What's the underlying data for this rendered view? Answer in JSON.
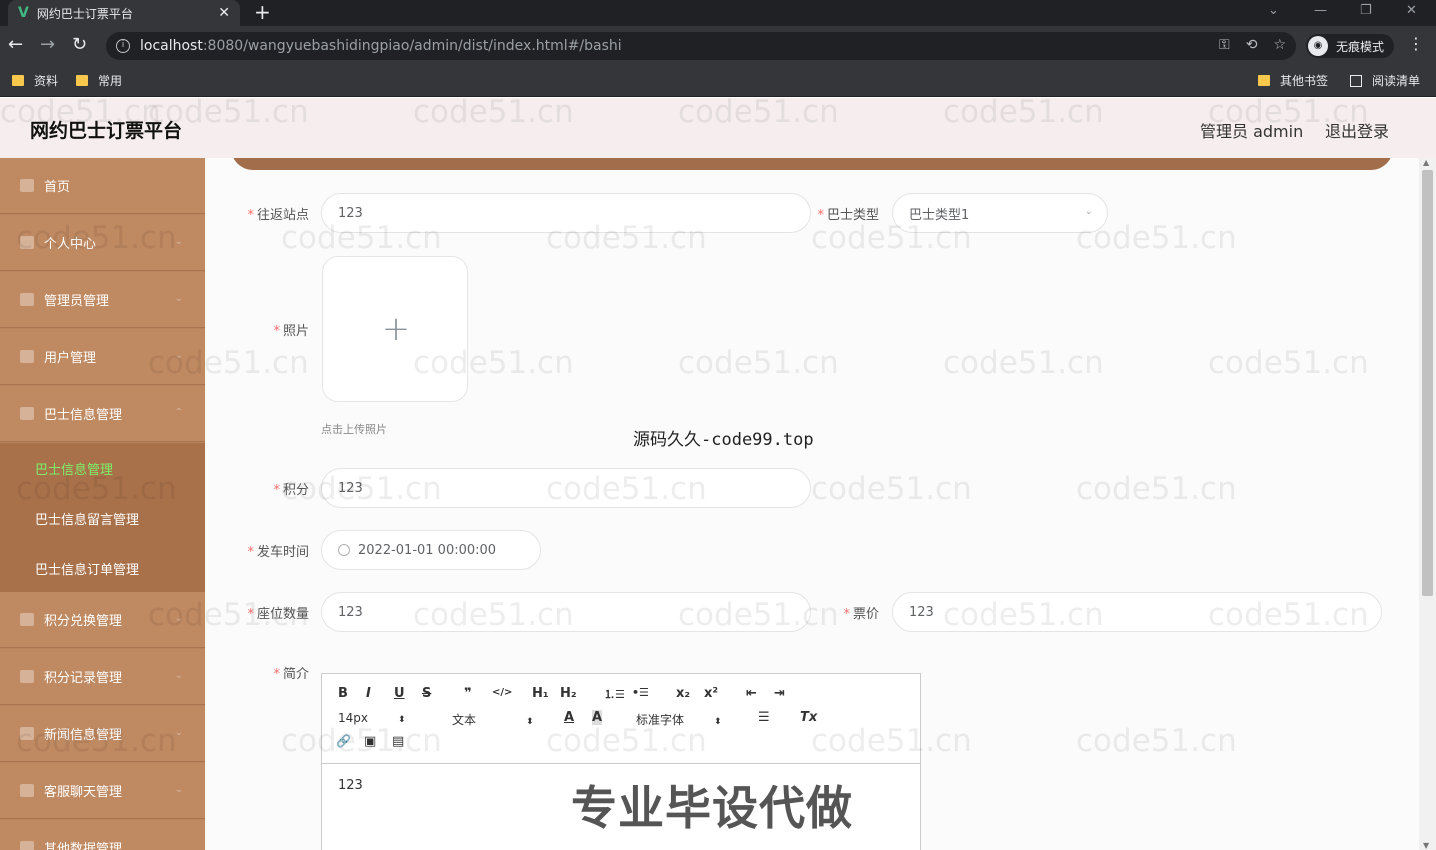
{
  "browser": {
    "tab_title": "网约巴士订票平台",
    "tab_close": "✕",
    "new_tab": "+",
    "url_host": "localhost",
    "url_rest": ":8080/wangyuebashidingpiao/admin/dist/index.html#/bashi",
    "incognito_label": "无痕模式",
    "bookmarks": [
      "资料",
      "常用"
    ],
    "other_bookmarks": "其他书签",
    "reading_list": "阅读清单"
  },
  "header": {
    "title": "网约巴士订票平台",
    "user": "管理员 admin",
    "logout": "退出登录"
  },
  "sidebar": {
    "items": [
      {
        "label": "首页"
      },
      {
        "label": "个人中心"
      },
      {
        "label": "管理员管理"
      },
      {
        "label": "用户管理"
      },
      {
        "label": "巴士信息管理"
      }
    ],
    "sub_items": [
      {
        "label": "巴士信息管理"
      },
      {
        "label": "巴士信息留言管理"
      },
      {
        "label": "巴士信息订单管理"
      }
    ],
    "items_after": [
      {
        "label": "积分兑换管理"
      },
      {
        "label": "积分记录管理"
      },
      {
        "label": "新闻信息管理"
      },
      {
        "label": "客服聊天管理"
      },
      {
        "label": "其他数据管理"
      }
    ]
  },
  "form": {
    "route_label": "往返站点",
    "route_value": "123",
    "bus_type_label": "巴士类型",
    "bus_type_value": "巴士类型1",
    "photo_label": "照片",
    "upload_tip": "点击上传照片",
    "points_label": "积分",
    "points_value": "123",
    "depart_label": "发车时间",
    "depart_value": "2022-01-01 00:00:00",
    "seats_label": "座位数量",
    "seats_value": "123",
    "price_label": "票价",
    "price_value": "123",
    "intro_label": "简介",
    "intro_value": "123"
  },
  "editor_toolbar": {
    "bold": "B",
    "italic": "I",
    "underline": "U",
    "strike": "S",
    "quote": "❞",
    "code": "</>",
    "h1": "H₁",
    "h2": "H₂",
    "ol": "⒈☰",
    "ul": "•☰",
    "sub": "x₂",
    "sup": "x²",
    "outdent": "⇤",
    "indent": "⇥",
    "font_size": "14px",
    "text_type": "文本",
    "font_family": "标准字体",
    "select_arrows": "⬍",
    "color": "A",
    "bg_color": "A",
    "align": "☰",
    "clear": "Tx",
    "link": "🔗",
    "image": "▣",
    "video": "▤"
  },
  "overlays": {
    "code99": "源码久久-code99.top",
    "promo": "专业毕设代做",
    "watermark": "code51.cn"
  }
}
